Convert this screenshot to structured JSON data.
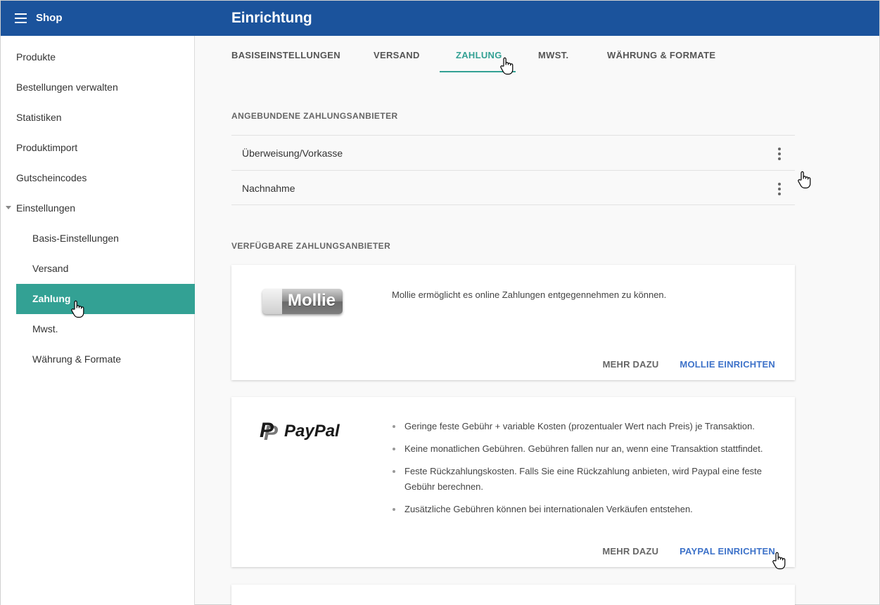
{
  "header": {
    "brand": "Shop",
    "title": "Einrichtung"
  },
  "sidebar": {
    "items": [
      {
        "label": "Produkte"
      },
      {
        "label": "Bestellungen verwalten"
      },
      {
        "label": "Statistiken"
      },
      {
        "label": "Produktimport"
      },
      {
        "label": "Gutscheincodes"
      },
      {
        "label": "Einstellungen"
      }
    ],
    "sub_items": [
      {
        "label": "Basis-Einstellungen"
      },
      {
        "label": "Versand"
      },
      {
        "label": "Zahlung"
      },
      {
        "label": "Mwst."
      },
      {
        "label": "Währung & Formate"
      }
    ],
    "active": "Zahlung"
  },
  "tabs": [
    {
      "label": "BASISEINSTELLUNGEN"
    },
    {
      "label": "VERSAND"
    },
    {
      "label": "ZAHLUNG"
    },
    {
      "label": "MWST."
    },
    {
      "label": "WÄHRUNG & FORMATE"
    }
  ],
  "active_tab": "ZAHLUNG",
  "connected": {
    "title": "ANGEBUNDENE ZAHLUNGSANBIETER",
    "providers": [
      {
        "name": "Überweisung/Vorkasse"
      },
      {
        "name": "Nachnahme"
      }
    ]
  },
  "available": {
    "title": "VERFÜGBARE ZAHLUNGSANBIETER",
    "mollie": {
      "logo": "Mollie",
      "description": "Mollie ermöglicht es online Zahlungen entgegennehmen zu können.",
      "more_label": "MEHR DAZU",
      "setup_label": "MOLLIE EINRICHTEN"
    },
    "paypal": {
      "logo": "PayPal",
      "bullets": [
        "Geringe feste Gebühr + variable Kosten (prozentualer Wert nach Preis) je Transaktion.",
        "Keine monatlichen Gebühren. Gebühren fallen nur an, wenn eine Transaktion stattfindet.",
        "Feste Rückzahlungskosten. Falls Sie eine Rückzahlung anbieten, wird Paypal eine feste Gebühr berechnen.",
        "Zusätzliche Gebühren können bei internationalen Verkäufen entstehen."
      ],
      "more_label": "MEHR DAZU",
      "setup_label": "PAYPAL EINRICHTEN"
    }
  },
  "colors": {
    "header": "#1b539c",
    "accent": "#33a194",
    "link": "#3d72c9"
  },
  "icons": {
    "menu": "hamburger-icon",
    "more": "kebab-icon",
    "pointer": "hand-cursor-icon"
  }
}
